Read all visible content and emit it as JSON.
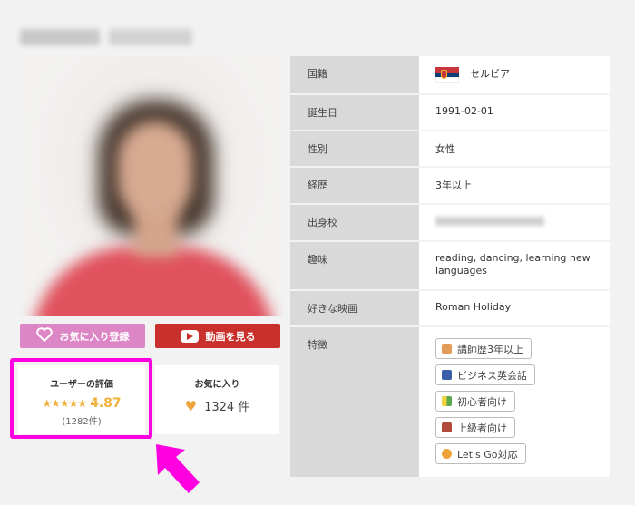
{
  "profile": {
    "favorite_button_label": "お気に入り登録",
    "video_button_label": "動画を見る"
  },
  "rating": {
    "title": "ユーザーの評価",
    "stars": "★★★★★",
    "score": "4.87",
    "count": "(1282件)"
  },
  "favorites": {
    "title": "お気に入り",
    "count": "1324 件"
  },
  "details": [
    {
      "label": "国籍",
      "value": "セルビア"
    },
    {
      "label": "誕生日",
      "value": "1991-02-01"
    },
    {
      "label": "性別",
      "value": "女性"
    },
    {
      "label": "経歴",
      "value": "3年以上"
    },
    {
      "label": "出身校",
      "value": ""
    },
    {
      "label": "趣味",
      "value": "reading, dancing, learning new languages"
    },
    {
      "label": "好きな映画",
      "value": "Roman Holiday"
    },
    {
      "label": "特徴",
      "value": ""
    }
  ],
  "features": [
    {
      "label": "講師歴3年以上",
      "color": "#e39b5a"
    },
    {
      "label": "ビジネス英会話",
      "color": "#3b5ea8"
    },
    {
      "label": "初心者向け",
      "color": "#6aa84f"
    },
    {
      "label": "上級者向け",
      "color": "#b04a3a"
    },
    {
      "label": "Let's Go対応",
      "color": "#f0a23a"
    }
  ],
  "colors": {
    "favorite_button": "#dc86c6",
    "video_button": "#c9302c",
    "highlight": "#ff00e0",
    "star": "#f0b13c"
  }
}
